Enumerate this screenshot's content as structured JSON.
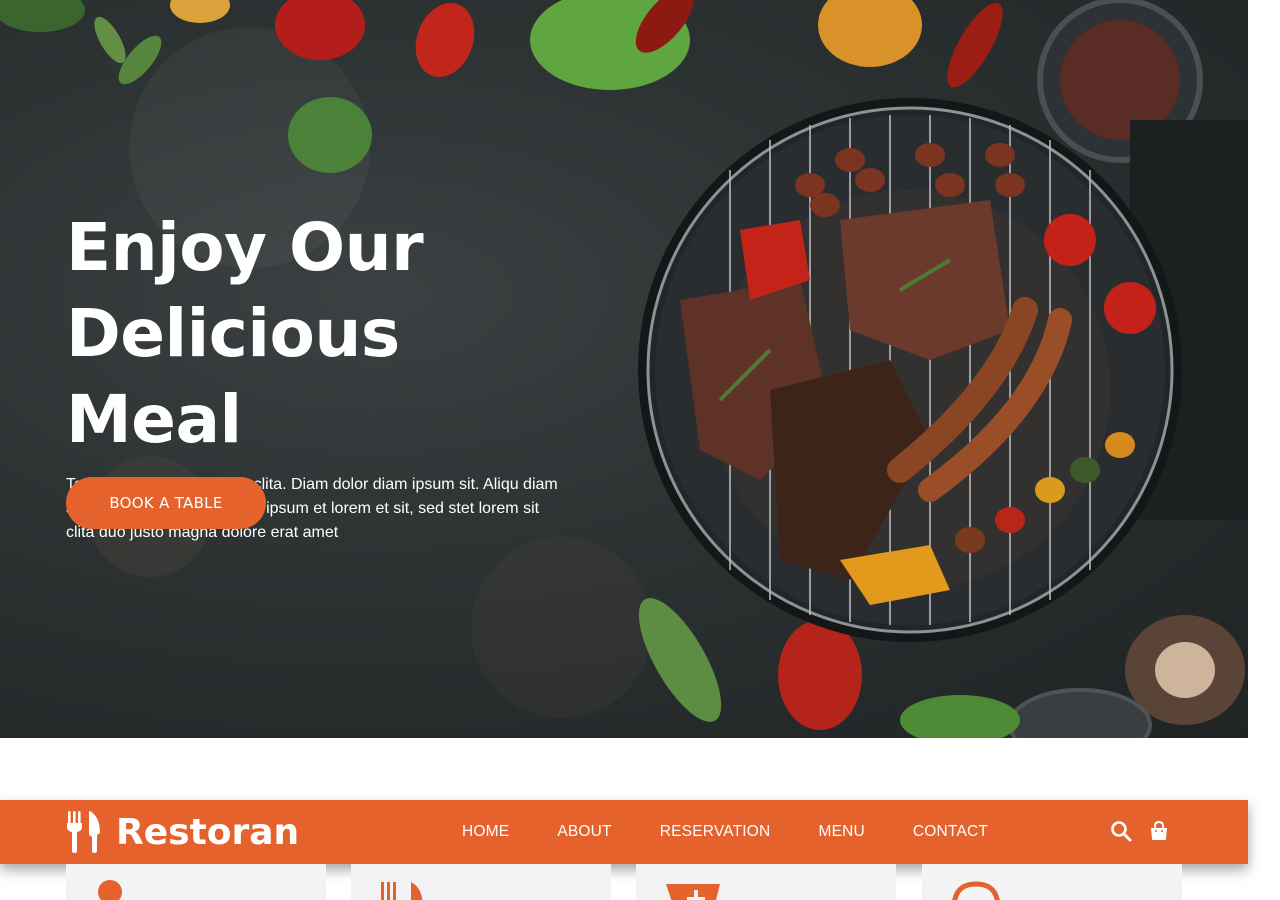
{
  "hero": {
    "title_line1": "Enjoy Our",
    "title_line2": "Delicious Meal",
    "description": "Tempor erat elitr rebum at clita. Diam dolor diam ipsum sit. Aliqu diam amet diam et eos. Clita erat ipsum et lorem et sit, sed stet lorem sit clita duo justo magna dolore erat amet",
    "cta_label": "BOOK A TABLE"
  },
  "navbar": {
    "brand": "Restoran",
    "brand_icon": "utensils-icon",
    "links": [
      {
        "label": "HOME"
      },
      {
        "label": "ABOUT"
      },
      {
        "label": "RESERVATION"
      },
      {
        "label": "MENU"
      },
      {
        "label": "CONTACT"
      }
    ],
    "icons": [
      "search-icon",
      "shopping-bag-icon"
    ]
  },
  "service_cards": [
    {
      "icon": "user-icon"
    },
    {
      "icon": "utensils-icon"
    },
    {
      "icon": "cart-plus-icon"
    },
    {
      "icon": "headset-icon"
    }
  ],
  "colors": {
    "accent": "#e5622d",
    "hero_bg": "#2c3132",
    "card_bg": "#f1f3f5",
    "text_light": "#ffffff"
  }
}
